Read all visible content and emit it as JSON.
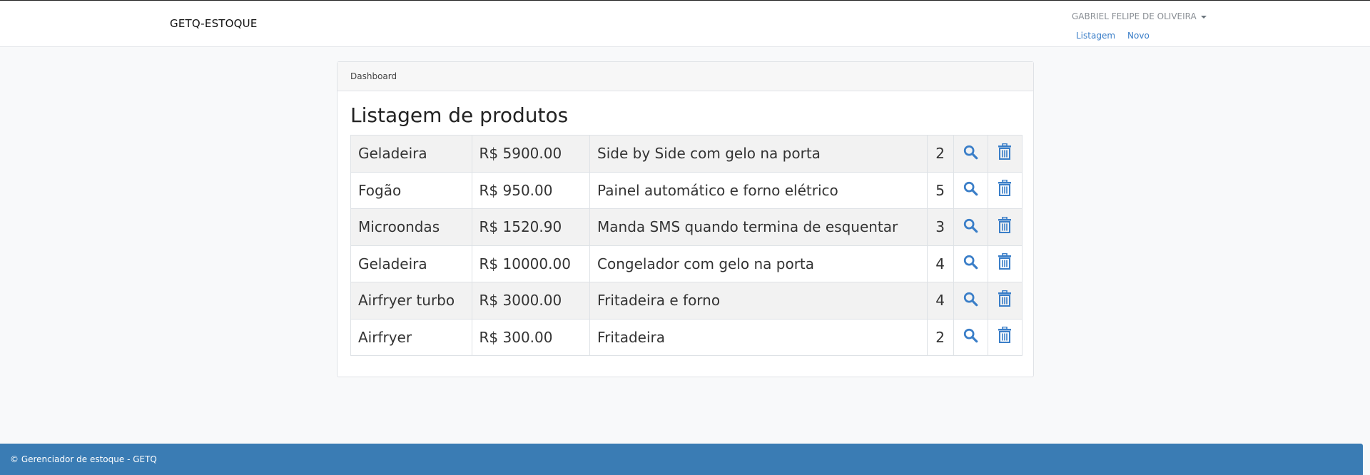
{
  "navbar": {
    "brand": "GETQ-ESTOQUE",
    "user": "GABRIEL FELIPE DE OLIVEIRA",
    "links": [
      "Listagem",
      "Novo"
    ]
  },
  "card": {
    "header": "Dashboard",
    "title": "Listagem de produtos",
    "rows": [
      {
        "name": "Geladeira",
        "price": "R$ 5900.00",
        "description": "Side by Side com gelo na porta",
        "qty": "2"
      },
      {
        "name": "Fogão",
        "price": "R$ 950.00",
        "description": "Painel automático e forno elétrico",
        "qty": "5"
      },
      {
        "name": "Microondas",
        "price": "R$ 1520.90",
        "description": "Manda SMS quando termina de esquentar",
        "qty": "3"
      },
      {
        "name": "Geladeira",
        "price": "R$ 10000.00",
        "description": "Congelador com gelo na porta",
        "qty": "4"
      },
      {
        "name": "Airfryer turbo",
        "price": "R$ 3000.00",
        "description": "Fritadeira e forno",
        "qty": "4"
      },
      {
        "name": "Airfryer",
        "price": "R$ 300.00",
        "description": "Fritadeira",
        "qty": "2"
      }
    ],
    "icons": {
      "view": "search-icon",
      "delete": "trash-icon"
    }
  },
  "footer": {
    "text": "© Gerenciador de estoque - GETQ"
  },
  "colors": {
    "link": "#3a7ec8",
    "icon": "#3a7ec8",
    "footer_bg": "#3a7cb4",
    "striped_row": "#f2f2f2"
  }
}
